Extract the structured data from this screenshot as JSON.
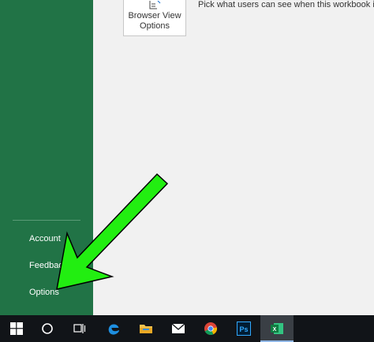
{
  "nav": {
    "items": [
      {
        "label": "Account"
      },
      {
        "label": "Feedback"
      },
      {
        "label": "Options"
      }
    ]
  },
  "main": {
    "browser_view_button": {
      "line1": "Browser View",
      "line2": "Options"
    },
    "browser_view_description": "Pick what users can see when this workbook is vie"
  },
  "annotation": {
    "arrow_color": "#22ee11",
    "arrow_icon": "green-arrow-icon",
    "points_to": "Options"
  },
  "taskbar": {
    "icons": [
      "windows-start-icon",
      "cortana-search-icon",
      "task-view-icon",
      "edge-icon",
      "file-explorer-icon",
      "mail-icon",
      "chrome-icon",
      "photoshop-icon",
      "excel-icon"
    ],
    "ps_label": "Ps",
    "excel_label": "X"
  },
  "colors": {
    "nav_bg": "#217346",
    "main_bg": "#f1f1f1",
    "taskbar_bg": "#111418"
  }
}
